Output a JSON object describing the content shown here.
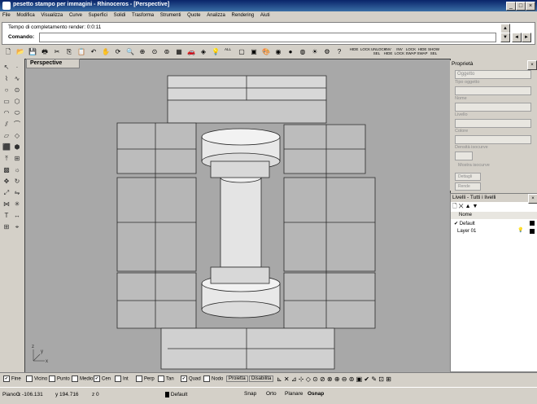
{
  "window": {
    "title": "pesetto stampo per immagini - Rhinoceros - [Perspective]"
  },
  "menu": [
    "File",
    "Modifica",
    "Visualizza",
    "Curve",
    "Superfici",
    "Solidi",
    "Trasforma",
    "Strumenti",
    "Quote",
    "Analizza",
    "Rendering",
    "Aiuti"
  ],
  "command": {
    "history": "Tempo di completamento render: 0:0:11",
    "prompt_label": "Comando:",
    "value": ""
  },
  "toolbar": {
    "labels": [
      "ALL",
      "HIDE",
      "LOCK",
      "UNLOCK SEL",
      "INV HIDE",
      "INV LOCK",
      "LOCK SWAP",
      "HIDE SWAP",
      "SHOW SEL"
    ]
  },
  "viewport": {
    "tab_label": "Perspective",
    "axis_x": "x",
    "axis_y": "y",
    "axis_z": "z"
  },
  "properties_panel": {
    "title": "Proprietà",
    "fields": [
      "Oggetto",
      "Tipo oggetto",
      "Nome",
      "Livello",
      "Colore",
      "Densità isocurve",
      "Mostra isocurve",
      "Dettagli",
      "Rende"
    ]
  },
  "layers_panel": {
    "title": "Livelli - Tutti i livelli",
    "column": "Nome",
    "rows": [
      "Default",
      "Layer 01"
    ]
  },
  "osnap": {
    "items": [
      {
        "label": "Fine",
        "checked": true
      },
      {
        "label": "Vicino",
        "checked": false
      },
      {
        "label": "Punto",
        "checked": false
      },
      {
        "label": "Medio",
        "checked": false
      },
      {
        "label": "Cen",
        "checked": true
      },
      {
        "label": "Int",
        "checked": false
      },
      {
        "label": "Perp",
        "checked": false
      },
      {
        "label": "Tan",
        "checked": false
      },
      {
        "label": "Quad",
        "checked": true
      },
      {
        "label": "Nodo",
        "checked": false
      }
    ],
    "proietta": "Proietta",
    "disabilita": "Disabilita"
  },
  "status": {
    "cplane": "PianoC",
    "x": "x -106.131",
    "y": "y 194.716",
    "z": "z 0",
    "layer": "Default",
    "snap": "Snap",
    "orto": "Orto",
    "planare": "Planare",
    "osnap": "Osnap"
  }
}
